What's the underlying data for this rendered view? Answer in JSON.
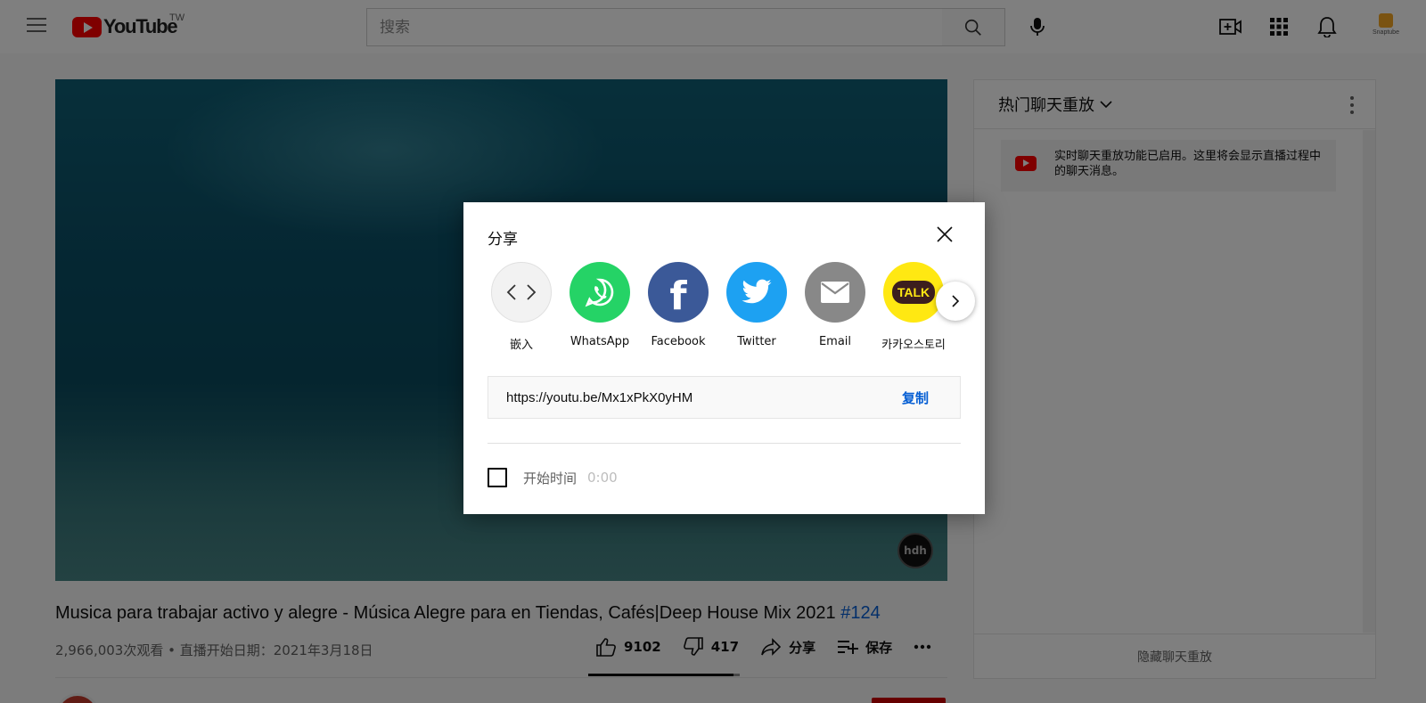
{
  "header": {
    "logo_text": "YouTube",
    "region": "TW",
    "search_placeholder": "搜索",
    "icons": [
      "menu-icon",
      "search-icon",
      "mic-icon",
      "create-video-icon",
      "apps-icon",
      "notifications-icon"
    ],
    "extension_label": "Snaptube"
  },
  "video": {
    "title": "Musica para trabajar activo y alegre - Música Alegre para en Tiendas, Cafés|Deep House Mix 2021",
    "hashtag": "#124",
    "views": "2,966,003次观看",
    "started": "直播开始日期：2021年3月18日",
    "meta_separator": " • ",
    "watermark": "hdh"
  },
  "actions": {
    "likes": "9102",
    "dislikes": "417",
    "share_label": "分享",
    "save_label": "保存",
    "like_ratio_percent": 95.6
  },
  "chat": {
    "header": "热门聊天重放",
    "notice": "实时聊天重放功能已启用。这里将会显示直播过程中的聊天消息。",
    "hide_label": "隐藏聊天重放"
  },
  "share_dialog": {
    "title": "分享",
    "targets": [
      {
        "label": "嵌入",
        "icon": "embed-icon",
        "color": "#f2f2f2"
      },
      {
        "label": "WhatsApp",
        "icon": "whatsapp-icon",
        "color": "#25d366"
      },
      {
        "label": "Facebook",
        "icon": "facebook-icon",
        "color": "#3b5998"
      },
      {
        "label": "Twitter",
        "icon": "twitter-icon",
        "color": "#1da1f2"
      },
      {
        "label": "Email",
        "icon": "email-icon",
        "color": "#888888"
      },
      {
        "label": "카카오스토리",
        "icon": "kakaotalk-icon",
        "color": "#ffe812"
      }
    ],
    "kakao_badge": "TALK",
    "url": "https://youtu.be/Mx1xPkX0yHM",
    "copy_label": "复制",
    "start_time_label": "开始时间",
    "start_time_value": "0:00",
    "start_time_checked": false
  }
}
